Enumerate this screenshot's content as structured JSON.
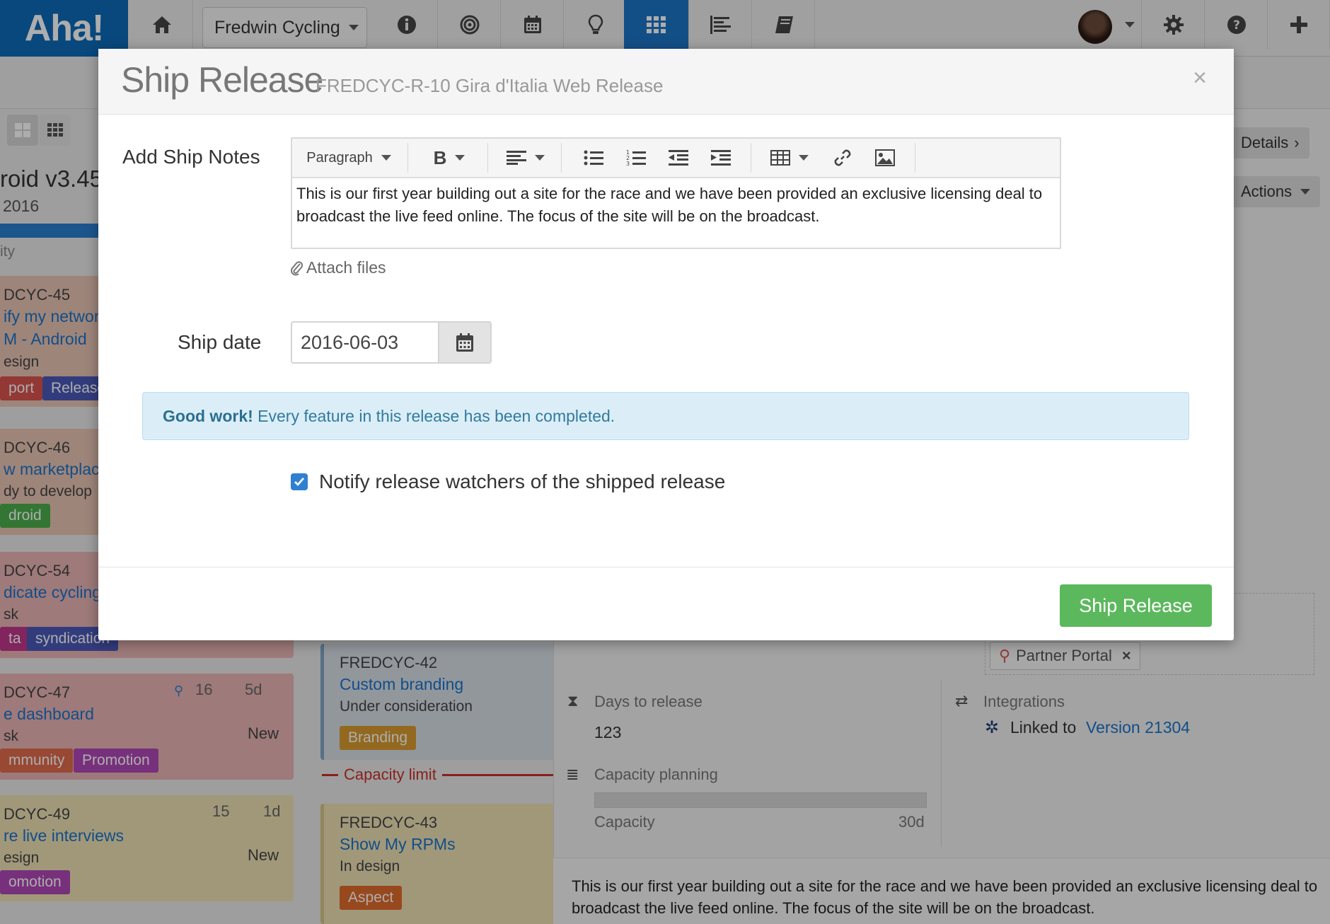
{
  "nav": {
    "logo": "Aha!",
    "workspace": "Fredwin Cycling",
    "icons": [
      "home-icon",
      "info-icon",
      "target-icon",
      "calendar-icon",
      "lightbulb-icon",
      "grid-icon",
      "roadmap-icon",
      "notebook-icon",
      "gear-icon",
      "help-icon",
      "plus-icon"
    ]
  },
  "background": {
    "release_title": "roid v3.45",
    "release_year": "2016",
    "column_label": "ity",
    "cards": [
      {
        "id": "DCYC-45",
        "name": "ify my networ",
        "name2": "M - Android",
        "status": "esign",
        "tags": [
          "port",
          "Release"
        ]
      },
      {
        "id": "DCYC-46",
        "name": "w marketplace",
        "status": "dy to develop",
        "tags": [
          "droid"
        ]
      },
      {
        "id": "DCYC-54",
        "name": "dicate cycling",
        "status": "sk",
        "tags": [
          "ta",
          "syndication"
        ]
      },
      {
        "id": "DCYC-47",
        "name": "e dashboard",
        "status": "sk",
        "score": "16",
        "time": "5d",
        "state": "New",
        "tags": [
          "mmunity",
          "Promotion"
        ]
      },
      {
        "id": "DCYC-49",
        "name": "re live interviews",
        "status": "esign",
        "score": "15",
        "time": "1d",
        "state": "New",
        "tags": [
          "omotion"
        ]
      }
    ],
    "mid_cards": [
      {
        "id": "FREDCYC-42",
        "name": "Custom branding",
        "status": "Under consideration",
        "tag": "Branding"
      },
      {
        "id": "FREDCYC-43",
        "name": "Show My RPMs",
        "status": "In design",
        "tag": "Aspect"
      }
    ],
    "capacity_limit": "Capacity limit",
    "details_button": "Details",
    "actions_button": "Actions",
    "partner_portal": "Partner Portal",
    "days_to_release_label": "Days to release",
    "days_to_release_value": "123",
    "capacity_planning_label": "Capacity planning",
    "capacity_label": "Capacity",
    "capacity_value": "30d",
    "integrations_label": "Integrations",
    "linked_to": "Linked to",
    "linked_version": "Version 21304",
    "notes_text": "This is our first year building out a site for the race and we have been provided an exclusive licensing deal to broadcast the live feed online. The focus of the site will be on the broadcast."
  },
  "modal": {
    "title": "Ship Release",
    "subtitle": "FREDCYC-R-10 Gira d'Italia Web Release",
    "close_glyph": "×",
    "ship_notes_label": "Add Ship Notes",
    "toolbar": {
      "paragraph": "Paragraph",
      "bold": "B"
    },
    "notes_text": "This is our first year building out a site for the race and we have been provided an exclusive licensing deal to broadcast the live feed online. The focus of the site will be on the broadcast.",
    "attach_files": "Attach files",
    "ship_date_label": "Ship date",
    "ship_date_value": "2016-06-03",
    "alert_strong": "Good work!",
    "alert_text": " Every feature in this release has been completed.",
    "notify_label": "Notify release watchers of the shipped release",
    "notify_checked": true,
    "ship_button": "Ship Release"
  },
  "colors": {
    "brand_blue": "#0d6ab8",
    "success_green": "#5cb85c",
    "info_bg": "#dbeef7",
    "link_blue": "#1b73c9"
  }
}
